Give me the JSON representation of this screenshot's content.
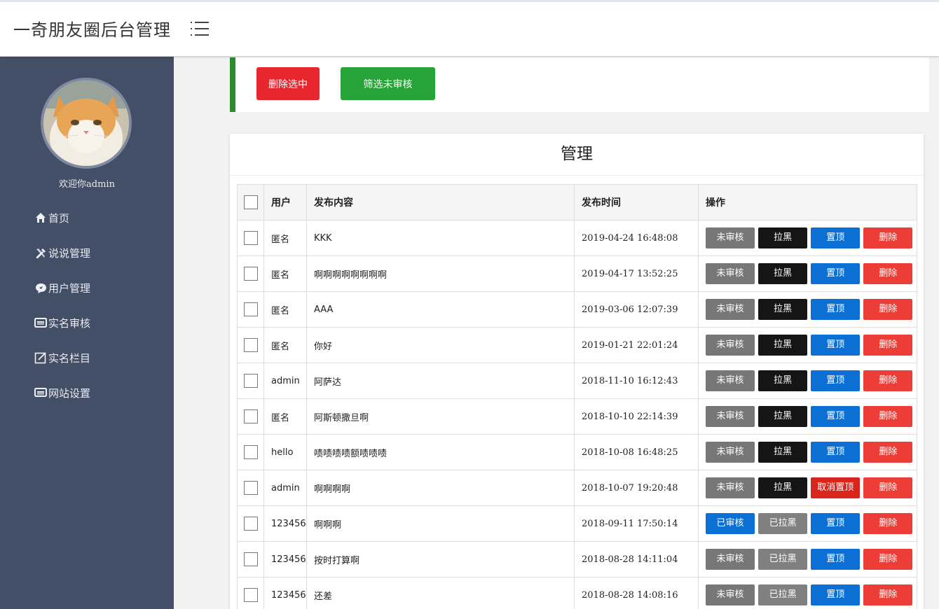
{
  "header": {
    "title": "一奇朋友圈后台管理"
  },
  "sidebar": {
    "welcome": "欢迎你admin",
    "items": [
      {
        "label": "首页",
        "icon": "home-icon"
      },
      {
        "label": "说说管理",
        "icon": "edit-tools-icon"
      },
      {
        "label": "用户管理",
        "icon": "chat-bubble-icon"
      },
      {
        "label": "实名审核",
        "icon": "id-card-icon"
      },
      {
        "label": "实名栏目",
        "icon": "pencil-square-icon"
      },
      {
        "label": "网站设置",
        "icon": "monitor-icon"
      }
    ]
  },
  "toolbar": {
    "delete_selected": "删除选中",
    "filter_unreviewed": "筛选未审核"
  },
  "panel": {
    "title": "管理"
  },
  "table": {
    "headers": {
      "user": "用户",
      "content": "发布内容",
      "time": "发布时间",
      "ops": "操作"
    },
    "rows": [
      {
        "user": "匿名",
        "content": "KKK",
        "time": "2019-04-24 16:48:08",
        "review": "未审核",
        "block": "拉黑",
        "pin": "置顶",
        "del": "删除",
        "review_state": "pending",
        "block_state": "active",
        "pin_state": "normal"
      },
      {
        "user": "匿名",
        "content": "啊啊啊啊啊啊啊啊",
        "time": "2019-04-17 13:52:25",
        "review": "未审核",
        "block": "拉黑",
        "pin": "置顶",
        "del": "删除",
        "review_state": "pending",
        "block_state": "active",
        "pin_state": "normal"
      },
      {
        "user": "匿名",
        "content": "AAA",
        "time": "2019-03-06 12:07:39",
        "review": "未审核",
        "block": "拉黑",
        "pin": "置顶",
        "del": "删除",
        "review_state": "pending",
        "block_state": "active",
        "pin_state": "normal"
      },
      {
        "user": "匿名",
        "content": "你好",
        "time": "2019-01-21 22:01:24",
        "review": "未审核",
        "block": "拉黑",
        "pin": "置顶",
        "del": "删除",
        "review_state": "pending",
        "block_state": "active",
        "pin_state": "normal"
      },
      {
        "user": "admin",
        "content": "阿萨达",
        "time": "2018-11-10 16:12:43",
        "review": "未审核",
        "block": "拉黑",
        "pin": "置顶",
        "del": "删除",
        "review_state": "pending",
        "block_state": "active",
        "pin_state": "normal"
      },
      {
        "user": "匿名",
        "content": "阿斯顿撒旦啊",
        "time": "2018-10-10 22:14:39",
        "review": "未审核",
        "block": "拉黑",
        "pin": "置顶",
        "del": "删除",
        "review_state": "pending",
        "block_state": "active",
        "pin_state": "normal"
      },
      {
        "user": "hello",
        "content": "啧啧啧啧额啧啧啧",
        "time": "2018-10-08 16:48:25",
        "review": "未审核",
        "block": "拉黑",
        "pin": "置顶",
        "del": "删除",
        "review_state": "pending",
        "block_state": "active",
        "pin_state": "normal"
      },
      {
        "user": "admin",
        "content": "啊啊啊啊",
        "time": "2018-10-07 19:20:48",
        "review": "未审核",
        "block": "拉黑",
        "pin": "取消置顶",
        "del": "删除",
        "review_state": "pending",
        "block_state": "active",
        "pin_state": "pinned"
      },
      {
        "user": "123456",
        "content": "啊啊啊",
        "time": "2018-09-11 17:50:14",
        "review": "已审核",
        "block": "已拉黑",
        "pin": "置顶",
        "del": "删除",
        "review_state": "approved",
        "block_state": "blocked",
        "pin_state": "normal"
      },
      {
        "user": "123456",
        "content": "按时打算啊",
        "time": "2018-08-28 14:11:04",
        "review": "未审核",
        "block": "已拉黑",
        "pin": "置顶",
        "del": "删除",
        "review_state": "pending",
        "block_state": "blocked",
        "pin_state": "normal"
      },
      {
        "user": "123456",
        "content": "还差",
        "time": "2018-08-28 14:08:16",
        "review": "未审核",
        "block": "已拉黑",
        "pin": "置顶",
        "del": "删除",
        "review_state": "pending",
        "block_state": "blocked",
        "pin_state": "normal"
      }
    ]
  },
  "colors": {
    "pending": "#777777",
    "approved": "#0b6fd3",
    "active": "#151515",
    "blocked": "#808080",
    "normal": "#0b6fd3",
    "pinned": "#d9261c",
    "delete": "#ec3e36"
  }
}
